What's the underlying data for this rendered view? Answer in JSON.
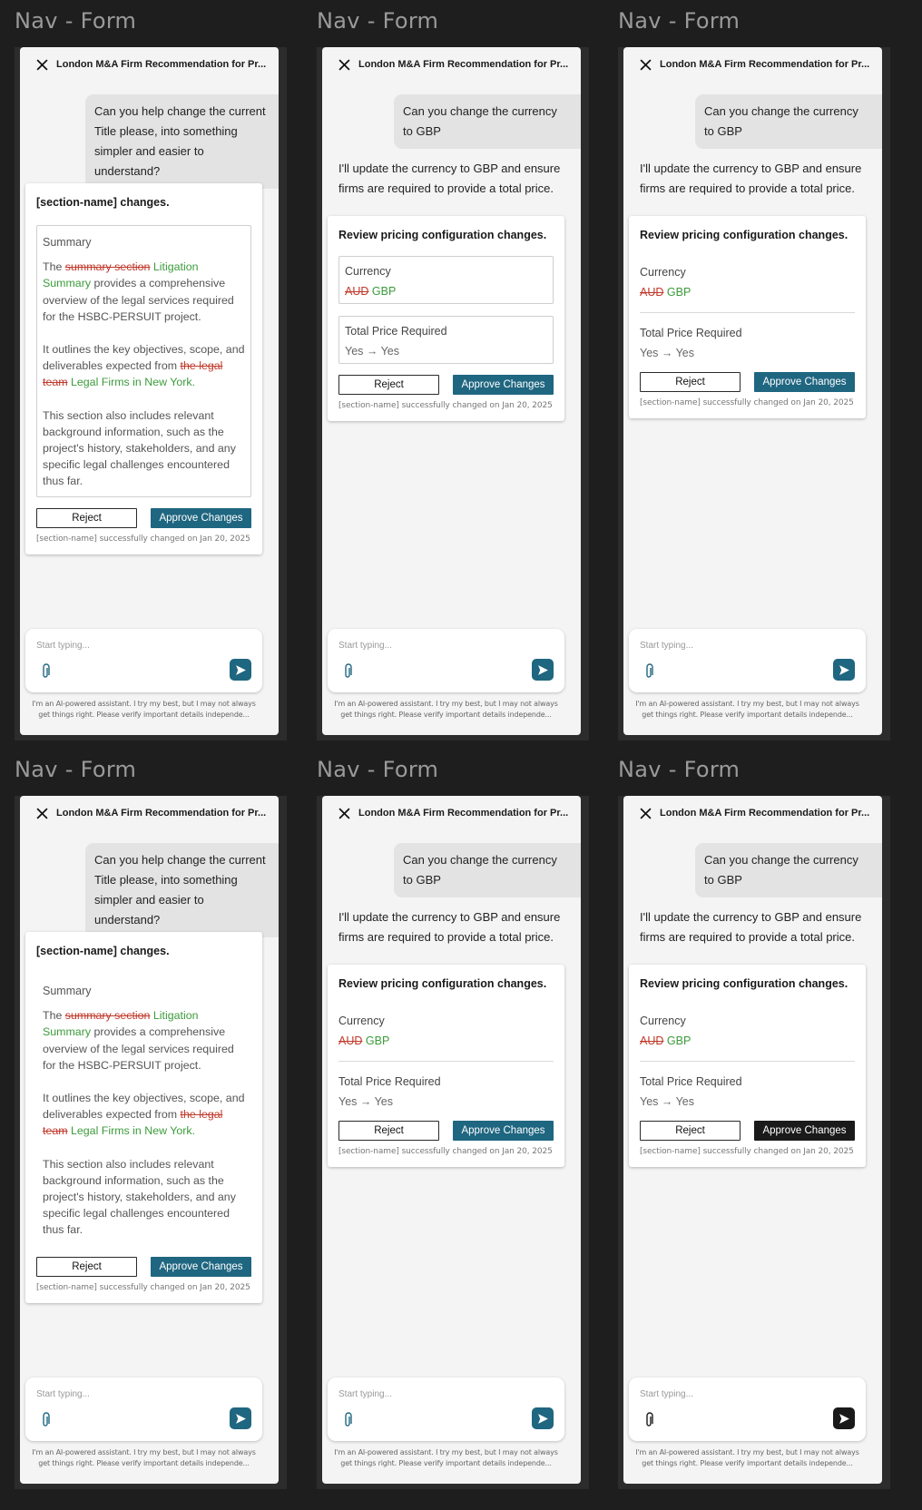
{
  "frame_label": "Nav - Form",
  "header": {
    "title": "London M&A Firm Recommendation for Pr..."
  },
  "summary_flow": {
    "user_message": "Can you help change the current Title please, into something simpler and easier to understand?",
    "card_title": "[section-name] changes.",
    "summary_heading": "Summary",
    "p1_lead": "The ",
    "p1_deleted": "summary section",
    "p1_inserted": "Litigation Summary",
    "p1_rest": " provides a comprehensive overview of the legal services required for the HSBC-PERSUIT project.",
    "p2_lead": "It outlines the key objectives, scope, and deliverables expected from ",
    "p2_deleted": "the legal team",
    "p2_inserted": "Legal Firms in New York.",
    "p3": "This section also includes relevant background information, such as the project's history, stakeholders, and any specific legal challenges encountered thus far."
  },
  "currency_flow": {
    "user_message": "Can you change the currency to GBP",
    "assistant_message": "I'll update the currency to GBP and ensure firms are required to provide a total price.",
    "card_title": "Review pricing configuration changes.",
    "currency_label": "Currency",
    "currency_old": "AUD",
    "currency_new": "GBP",
    "total_label": "Total Price Required",
    "total_value": "Yes → Yes"
  },
  "actions": {
    "reject_label": "Reject",
    "approve_label": "Approve Changes",
    "status_text": "[section-name] successfully changed on Jan 20, 2025"
  },
  "composer": {
    "placeholder": "Start typing...",
    "disclaimer": "I'm an AI-powered assistant. I try my best, but I may not always get things right. Please verify important details independe..."
  },
  "colors": {
    "accent": "#1f6680",
    "dark_accent": "#1a1a1a",
    "deleted": "#c0392b",
    "inserted": "#3c9b3c"
  }
}
